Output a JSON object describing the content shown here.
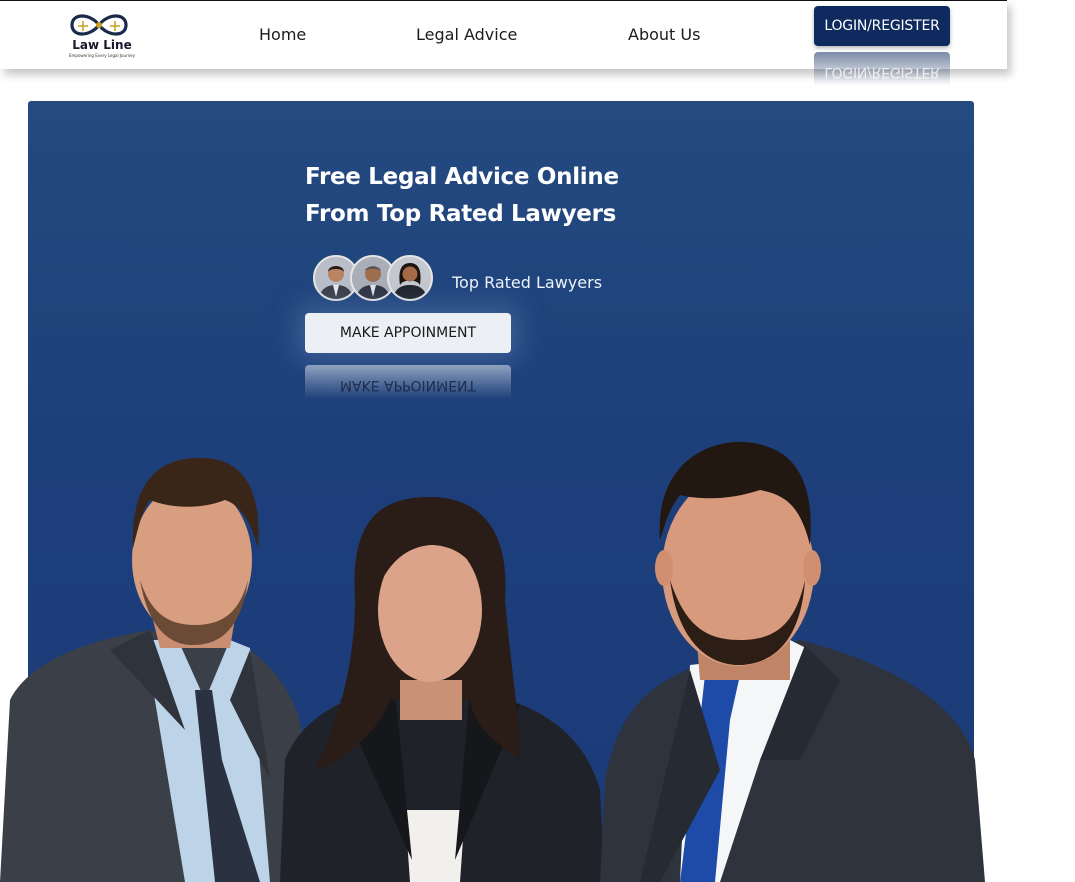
{
  "header": {
    "logo": {
      "name": "Law Line",
      "tagline": "Empowering Every Legal Journey"
    },
    "nav": [
      {
        "label": "Home"
      },
      {
        "label": "Legal Advice"
      },
      {
        "label": "About Us"
      }
    ],
    "login_label": "LOGIN/REGISTER"
  },
  "hero": {
    "title_line1": "Free Legal Advice Online",
    "title_line2": "From Top Rated Lawyers",
    "lawyers_caption": "Top Rated Lawyers",
    "cta_label": "MAKE APPOINMENT"
  },
  "colors": {
    "brand_navy": "#0f2a5e",
    "hero_blue": "#1d3f7a",
    "button_light": "#eceff3"
  }
}
